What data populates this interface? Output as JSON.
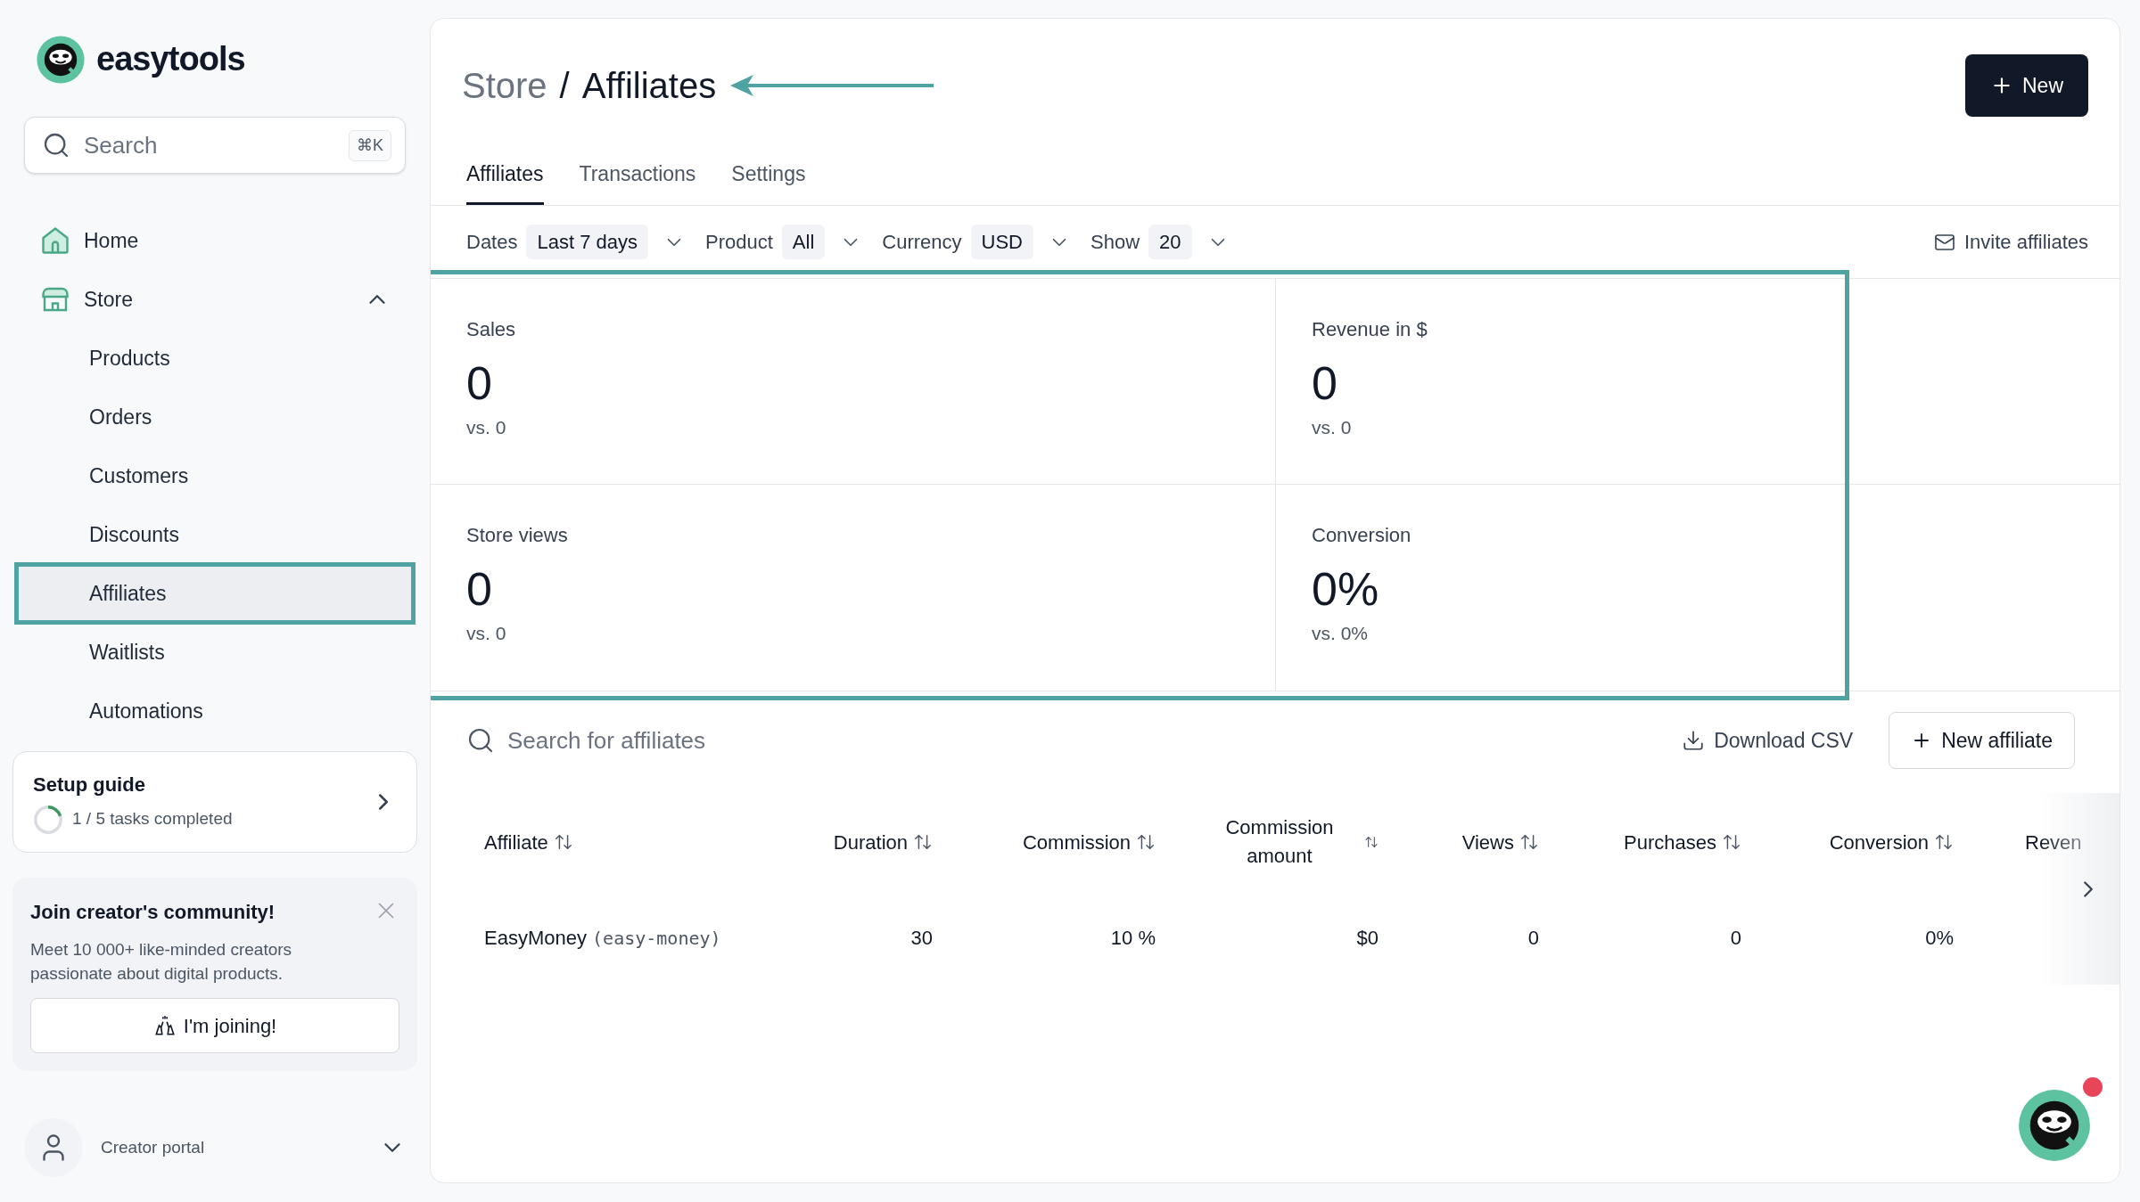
{
  "brand": {
    "name": "easytools"
  },
  "search": {
    "placeholder": "Search",
    "shortcut": "⌘K"
  },
  "nav": [
    {
      "label": "Home"
    },
    {
      "label": "Store",
      "expanded": true,
      "children": [
        {
          "label": "Products",
          "selected": false
        },
        {
          "label": "Orders",
          "selected": false
        },
        {
          "label": "Customers",
          "selected": false
        },
        {
          "label": "Discounts",
          "selected": false
        },
        {
          "label": "Affiliates",
          "selected": true
        },
        {
          "label": "Waitlists",
          "selected": false
        },
        {
          "label": "Automations",
          "selected": false
        }
      ]
    }
  ],
  "setup_guide": {
    "title": "Setup guide",
    "progress": "1 / 5 tasks completed",
    "level": 0.2
  },
  "community": {
    "title": "Join creator's community!",
    "text": "Meet 10 000+ like-minded creators passionate about digital products.",
    "button": "I'm joining!"
  },
  "account": {
    "label": "Creator portal"
  },
  "breadcrumb": {
    "parent": "Store",
    "separator": "/",
    "current": "Affiliates"
  },
  "new_button": "New",
  "tabs": [
    {
      "label": "Affiliates",
      "selected": true
    },
    {
      "label": "Transactions",
      "selected": false
    },
    {
      "label": "Settings",
      "selected": false
    }
  ],
  "filters": [
    {
      "label": "Dates",
      "value": "Last 7 days"
    },
    {
      "label": "Product",
      "value": "All"
    },
    {
      "label": "Currency",
      "value": "USD"
    },
    {
      "label": "Show",
      "value": "20"
    }
  ],
  "invite": "Invite affiliates",
  "stats": [
    {
      "label": "Sales",
      "value": "0",
      "comparison": "vs. 0"
    },
    {
      "label": "Revenue in $",
      "value": "0",
      "comparison": "vs. 0"
    },
    {
      "label": "Store views",
      "value": "0",
      "comparison": "vs. 0"
    },
    {
      "label": "Conversion",
      "value": "0%",
      "comparison": "vs. 0%"
    }
  ],
  "affiliate_search": {
    "placeholder": "Search for affiliates"
  },
  "download": "Download CSV",
  "new_affiliate": "New affiliate",
  "table": {
    "columns": [
      {
        "label": "Affiliate",
        "sortable": true
      },
      {
        "label": "Duration",
        "sortable": true
      },
      {
        "label": "Commission",
        "sortable": true
      },
      {
        "label": "Commission amount",
        "sortable": true
      },
      {
        "label": "Views",
        "sortable": true
      },
      {
        "label": "Purchases",
        "sortable": true
      },
      {
        "label": "Conversion",
        "sortable": true
      },
      {
        "label": "Reven",
        "sortable": false
      }
    ],
    "rows": [
      {
        "affiliate": "EasyMoney",
        "handle": "(easy-money)",
        "values": [
          "30",
          "10 %",
          "$0",
          "0",
          "0",
          "0%"
        ]
      }
    ]
  }
}
